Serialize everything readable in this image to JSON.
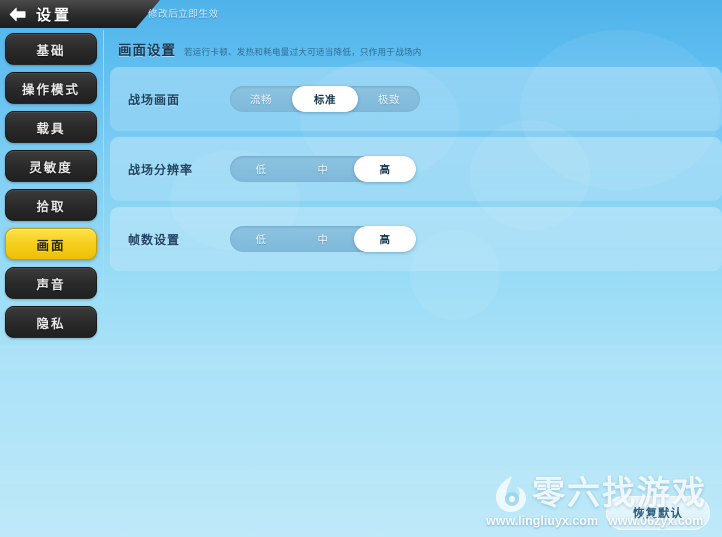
{
  "header": {
    "back_icon": "back-arrow-icon",
    "title": "设置",
    "hint": "修改后立即生效"
  },
  "sidebar": {
    "items": [
      {
        "label": "基础",
        "active": false
      },
      {
        "label": "操作模式",
        "active": false
      },
      {
        "label": "载具",
        "active": false
      },
      {
        "label": "灵敏度",
        "active": false
      },
      {
        "label": "拾取",
        "active": false
      },
      {
        "label": "画面",
        "active": true
      },
      {
        "label": "声音",
        "active": false
      },
      {
        "label": "隐私",
        "active": false
      }
    ]
  },
  "section": {
    "title": "画面设置",
    "description": "若运行卡顿、发热和耗电量过大可适当降低，只作用于战场内"
  },
  "rows": [
    {
      "label": "战场画面",
      "options": [
        "流畅",
        "标准",
        "极致"
      ],
      "selected": "标准",
      "selected_index": 1
    },
    {
      "label": "战场分辨率",
      "options": [
        "低",
        "中",
        "高"
      ],
      "selected": "高",
      "selected_index": 2
    },
    {
      "label": "帧数设置",
      "options": [
        "低",
        "中",
        "高"
      ],
      "selected": "高",
      "selected_index": 2
    }
  ],
  "restore_button": {
    "label": "恢复默认"
  },
  "watermark": {
    "brand": "零六找游戏",
    "url_left": "www.lingliuyx.com",
    "url_right": "www.06zyx.com",
    "logo_icon": "flame-swirl-logo-icon"
  },
  "colors": {
    "accent_yellow": "#f6cf1d",
    "header_dark": "#2b2b2b",
    "bg_top": "#4fb3e9",
    "bg_bottom": "#bfe9f9",
    "segment_track": "#85bfdd",
    "selected_pill": "#ffffff"
  }
}
